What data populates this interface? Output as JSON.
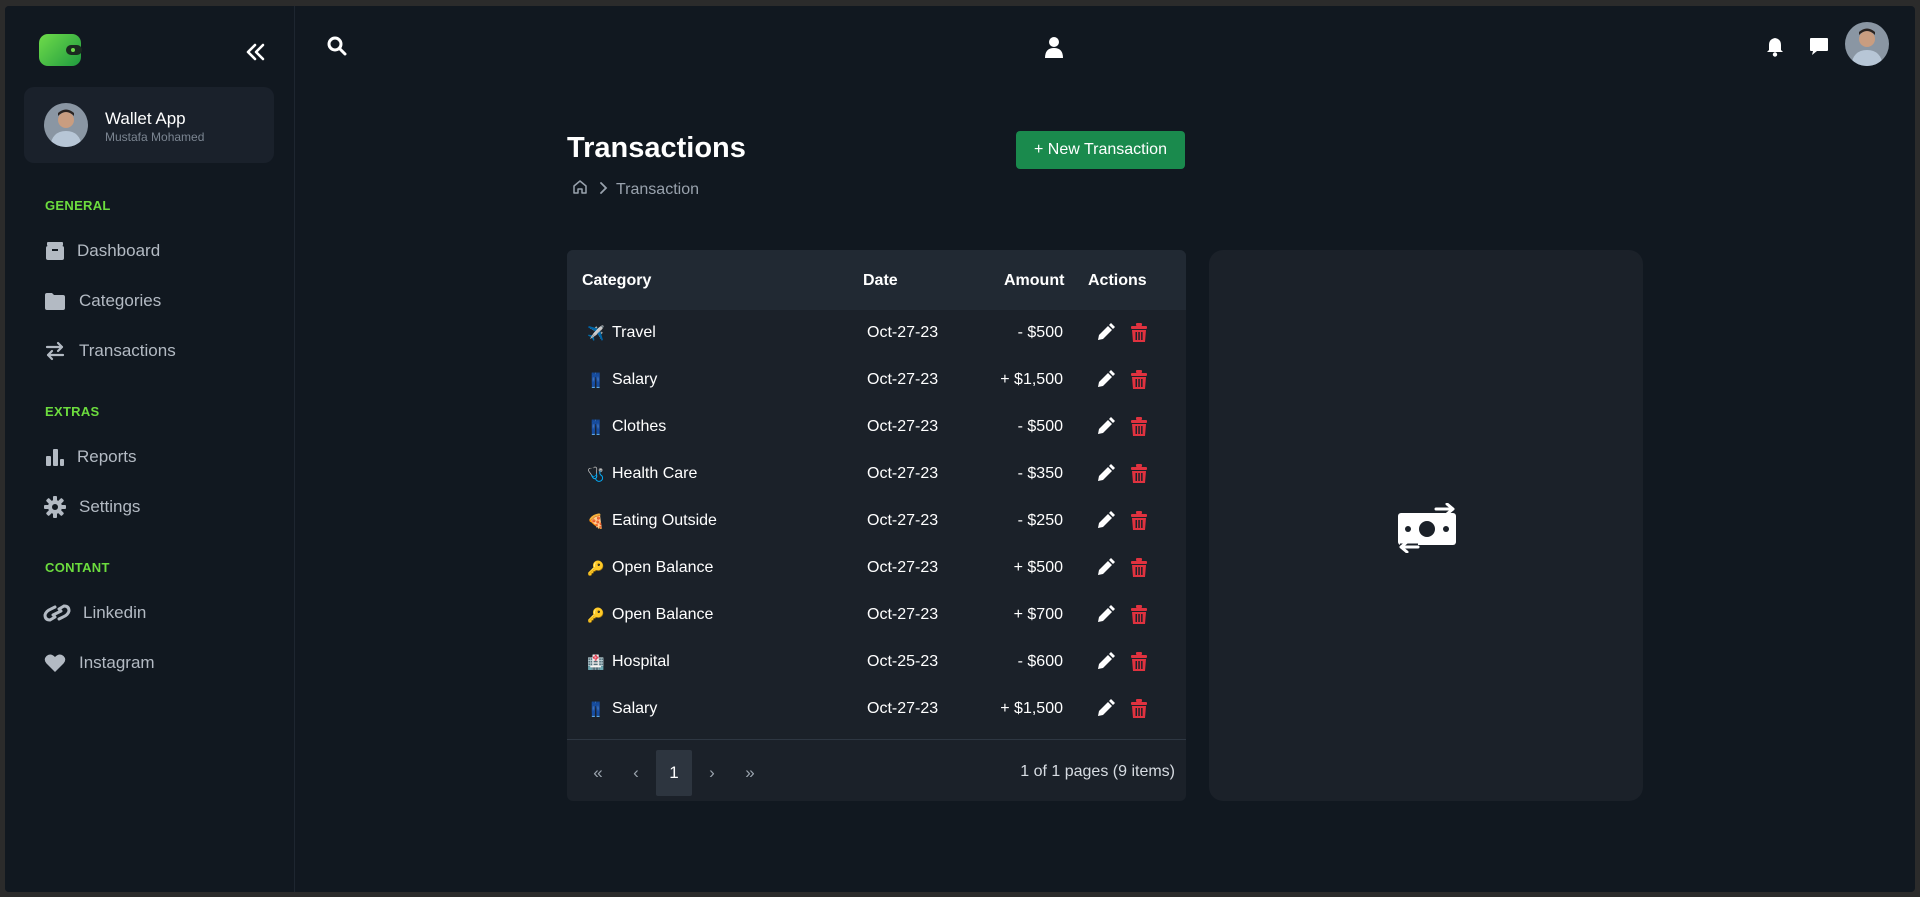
{
  "sidebar": {
    "profile": {
      "name": "Wallet App",
      "subtitle": "Mustafa Mohamed"
    },
    "sections": [
      {
        "title": "GENERAL",
        "items": [
          {
            "label": "Dashboard",
            "icon": "box-icon"
          },
          {
            "label": "Categories",
            "icon": "folder-icon"
          },
          {
            "label": "Transactions",
            "icon": "arrows-icon"
          }
        ]
      },
      {
        "title": "EXTRAS",
        "items": [
          {
            "label": "Reports",
            "icon": "bar-chart-icon"
          },
          {
            "label": "Settings",
            "icon": "gear-icon"
          }
        ]
      },
      {
        "title": "CONTANT",
        "items": [
          {
            "label": "Linkedin",
            "icon": "link-icon"
          },
          {
            "label": "Instagram",
            "icon": "heart-icon"
          }
        ]
      }
    ]
  },
  "header": {
    "title": "Transactions",
    "new_button": "+ New Transaction",
    "breadcrumb": "Transaction"
  },
  "table": {
    "columns": [
      "Category",
      "Date",
      "Amount",
      "Actions"
    ],
    "rows": [
      {
        "icon": "✈️",
        "category": "Travel",
        "date": "Oct-27-23",
        "amount": "- $500"
      },
      {
        "icon": "👖",
        "category": "Salary",
        "date": "Oct-27-23",
        "amount": "+ $1,500"
      },
      {
        "icon": "👖",
        "category": "Clothes",
        "date": "Oct-27-23",
        "amount": "- $500"
      },
      {
        "icon": "🩺",
        "category": "Health Care",
        "date": "Oct-27-23",
        "amount": "- $350"
      },
      {
        "icon": "🍕",
        "category": "Eating Outside",
        "date": "Oct-27-23",
        "amount": "- $250"
      },
      {
        "icon": "🔑",
        "category": "Open Balance",
        "date": "Oct-27-23",
        "amount": "+ $500"
      },
      {
        "icon": "🔑",
        "category": "Open Balance",
        "date": "Oct-27-23",
        "amount": "+ $700"
      },
      {
        "icon": "🏥",
        "category": "Hospital",
        "date": "Oct-25-23",
        "amount": "- $600"
      },
      {
        "icon": "👖",
        "category": "Salary",
        "date": "Oct-27-23",
        "amount": "+ $1,500"
      }
    ],
    "pagination": {
      "first": "«",
      "prev": "‹",
      "current": "1",
      "next": "›",
      "last": "»",
      "info": "1 of 1 pages (9 items)"
    }
  },
  "colors": {
    "accent_green": "#1a8a4d",
    "section_green": "#6cdc3e",
    "delete_red": "#e0323f"
  }
}
